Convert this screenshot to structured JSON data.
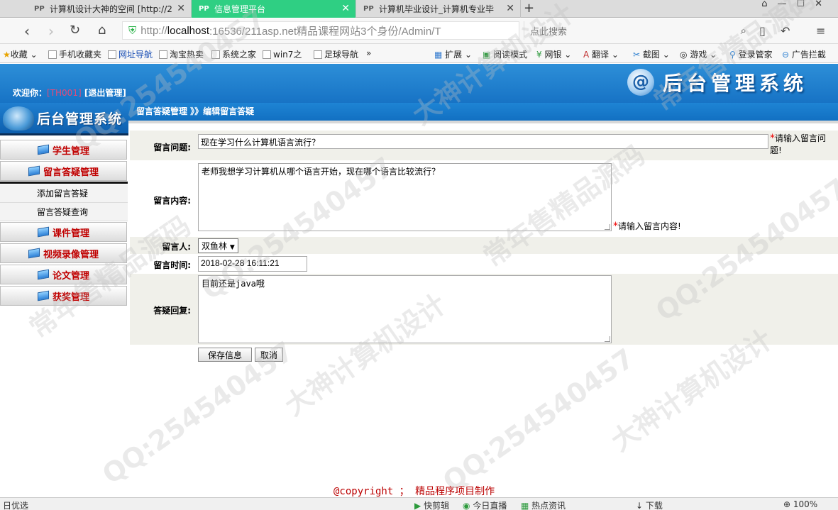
{
  "browser": {
    "tabs": [
      {
        "label": "计算机设计大神的空间 [http://2",
        "active": false
      },
      {
        "label": "信息管理平台",
        "active": true
      },
      {
        "label": "计算机毕业设计_计算机专业毕",
        "active": false
      }
    ],
    "url_prefix": "http://",
    "url_host": "localhost",
    "url_rest": ":16536/211asp.net精品课程网站3个身份/Admin/T",
    "search_placeholder": "点此搜索",
    "bookmarks": [
      "收藏",
      "手机收藏夹",
      "网址导航",
      "淘宝热卖",
      "系统之家",
      "win7之",
      "足球导航",
      "»"
    ],
    "tools": [
      "扩展",
      "阅读模式",
      "网银",
      "翻译",
      "截图",
      "游戏",
      "登录管家",
      "广告拦截"
    ]
  },
  "header": {
    "welcome_label": "欢迎你：",
    "username": "[TH001]",
    "logout": "[退出管理]",
    "logo_text": "后台管理系统"
  },
  "sidebar": {
    "logo_text": "后台管理系统",
    "items": [
      {
        "label": "学生管理"
      },
      {
        "label": "留言答疑管理"
      },
      {
        "label": "添加留言答疑"
      },
      {
        "label": "留言答疑查询"
      },
      {
        "label": "课件管理"
      },
      {
        "label": "视频录像管理"
      },
      {
        "label": "论文管理"
      },
      {
        "label": "获奖管理"
      }
    ]
  },
  "breadcrumb": "留言答疑管理 》》编辑留言答疑",
  "form": {
    "question_label": "留言问题:",
    "question_value": "现在学习什么计算机语言流行？",
    "question_hint": "请输入留言问题!",
    "content_label": "留言内容:",
    "content_value": "老师我想学习计算机从哪个语言开始，现在哪个语言比较流行？",
    "content_hint": "请输入留言内容!",
    "author_label": "留言人:",
    "author_value": "双鱼林",
    "time_label": "留言时间:",
    "time_value": "2018-02-28 16:11:21",
    "reply_label": "答疑回复:",
    "reply_value": "目前还是java哦",
    "save_label": "保存信息",
    "cancel_label": "取消",
    "required_mark": "*"
  },
  "footer": "@copyright ； 精品程序项目制作",
  "status": {
    "left": "日优选",
    "items": [
      "快剪辑",
      "今日直播",
      "热点资讯",
      "下载",
      "100%"
    ]
  },
  "watermarks": [
    "QQ:254540457",
    "大神计算机设计",
    "常年售精品源码"
  ],
  "colors": {
    "tab_active": "#2fcf83",
    "header_blue": "#1773c5",
    "menu_text": "#c00000",
    "form_gray": "#f0f0ea",
    "footer_text": "#b00000"
  }
}
